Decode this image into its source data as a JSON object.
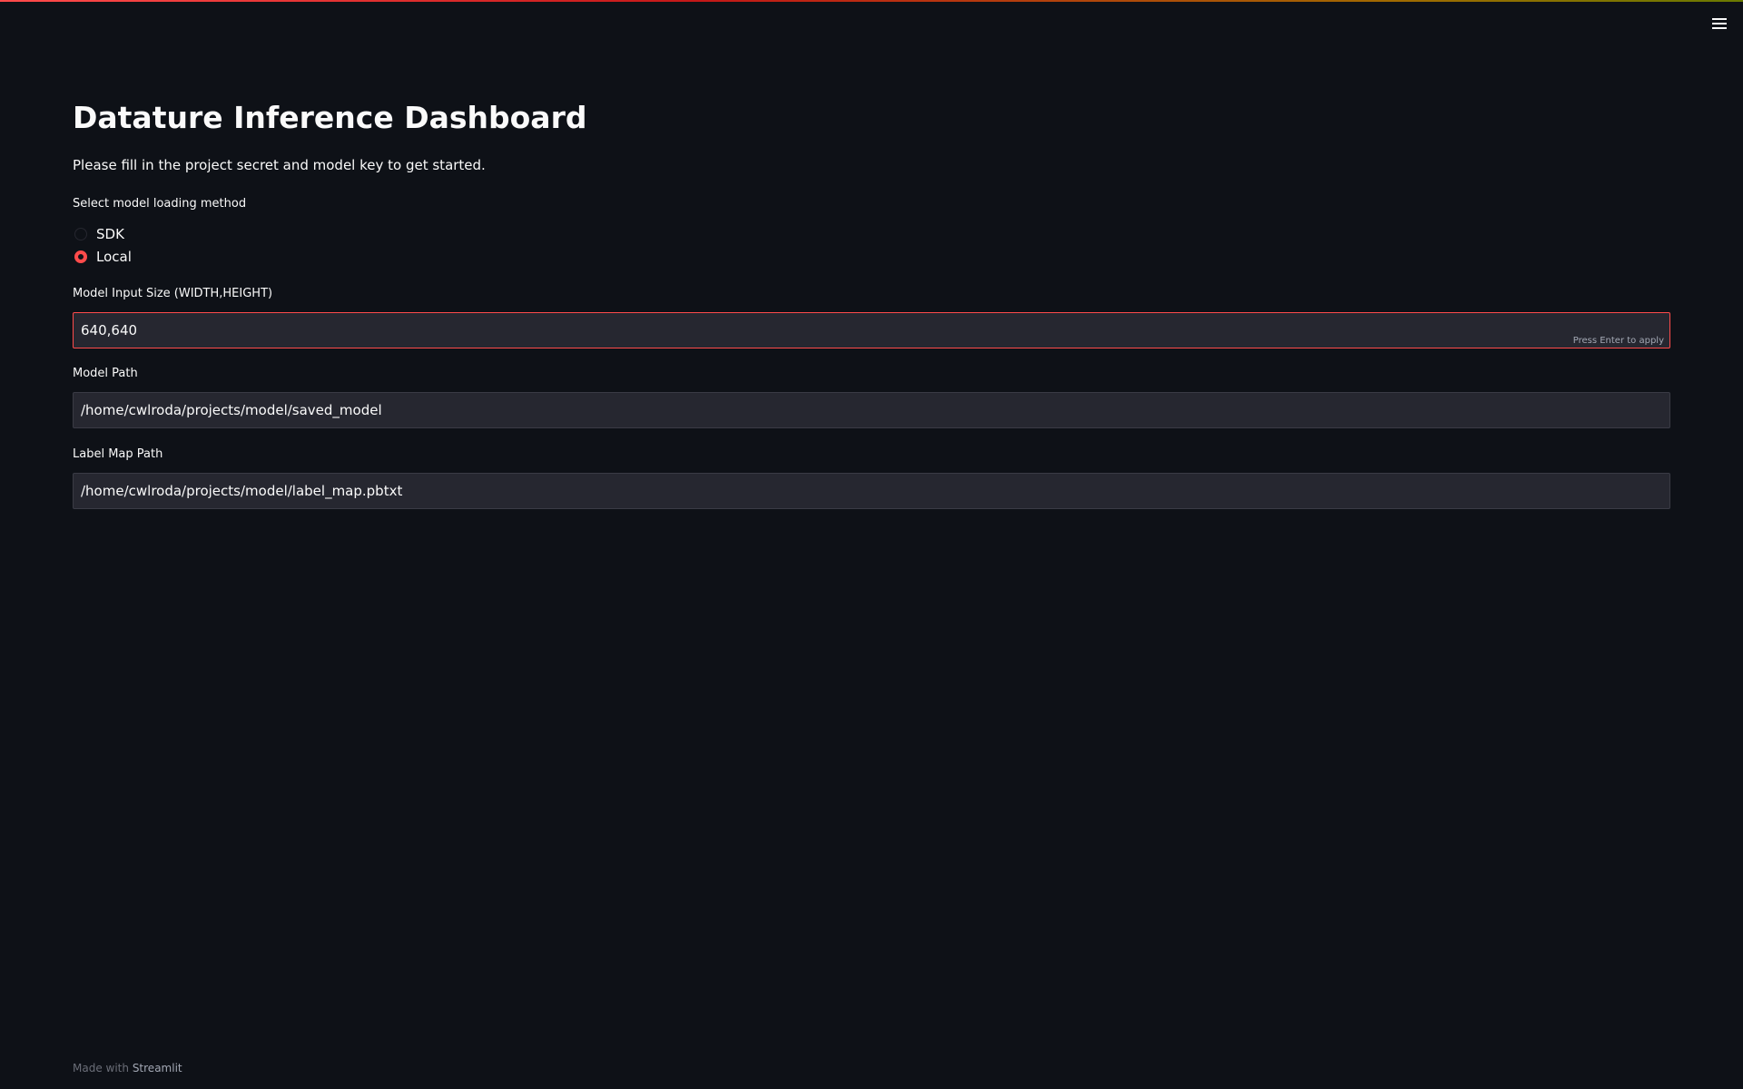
{
  "header": {
    "menu_icon": "hamburger-menu-icon"
  },
  "main": {
    "title": "Datature Inference Dashboard",
    "subtitle": "Please fill in the project secret and model key to get started.",
    "loading_method": {
      "label": "Select model loading method",
      "options": [
        {
          "label": "SDK",
          "selected": false
        },
        {
          "label": "Local",
          "selected": true
        }
      ]
    },
    "input_size": {
      "label": "Model Input Size (WIDTH,HEIGHT)",
      "value": "640,640",
      "hint": "Press Enter to apply"
    },
    "model_path": {
      "label": "Model Path",
      "value": "/home/cwlroda/projects/model/saved_model"
    },
    "label_map_path": {
      "label": "Label Map Path",
      "value": "/home/cwlroda/projects/model/label_map.pbtxt"
    }
  },
  "footer": {
    "prefix": "Made with",
    "brand": "Streamlit"
  },
  "colors": {
    "background": "#0e1117",
    "accent": "#ff4b4b",
    "input_bg": "#262730",
    "text": "#fafafa"
  }
}
